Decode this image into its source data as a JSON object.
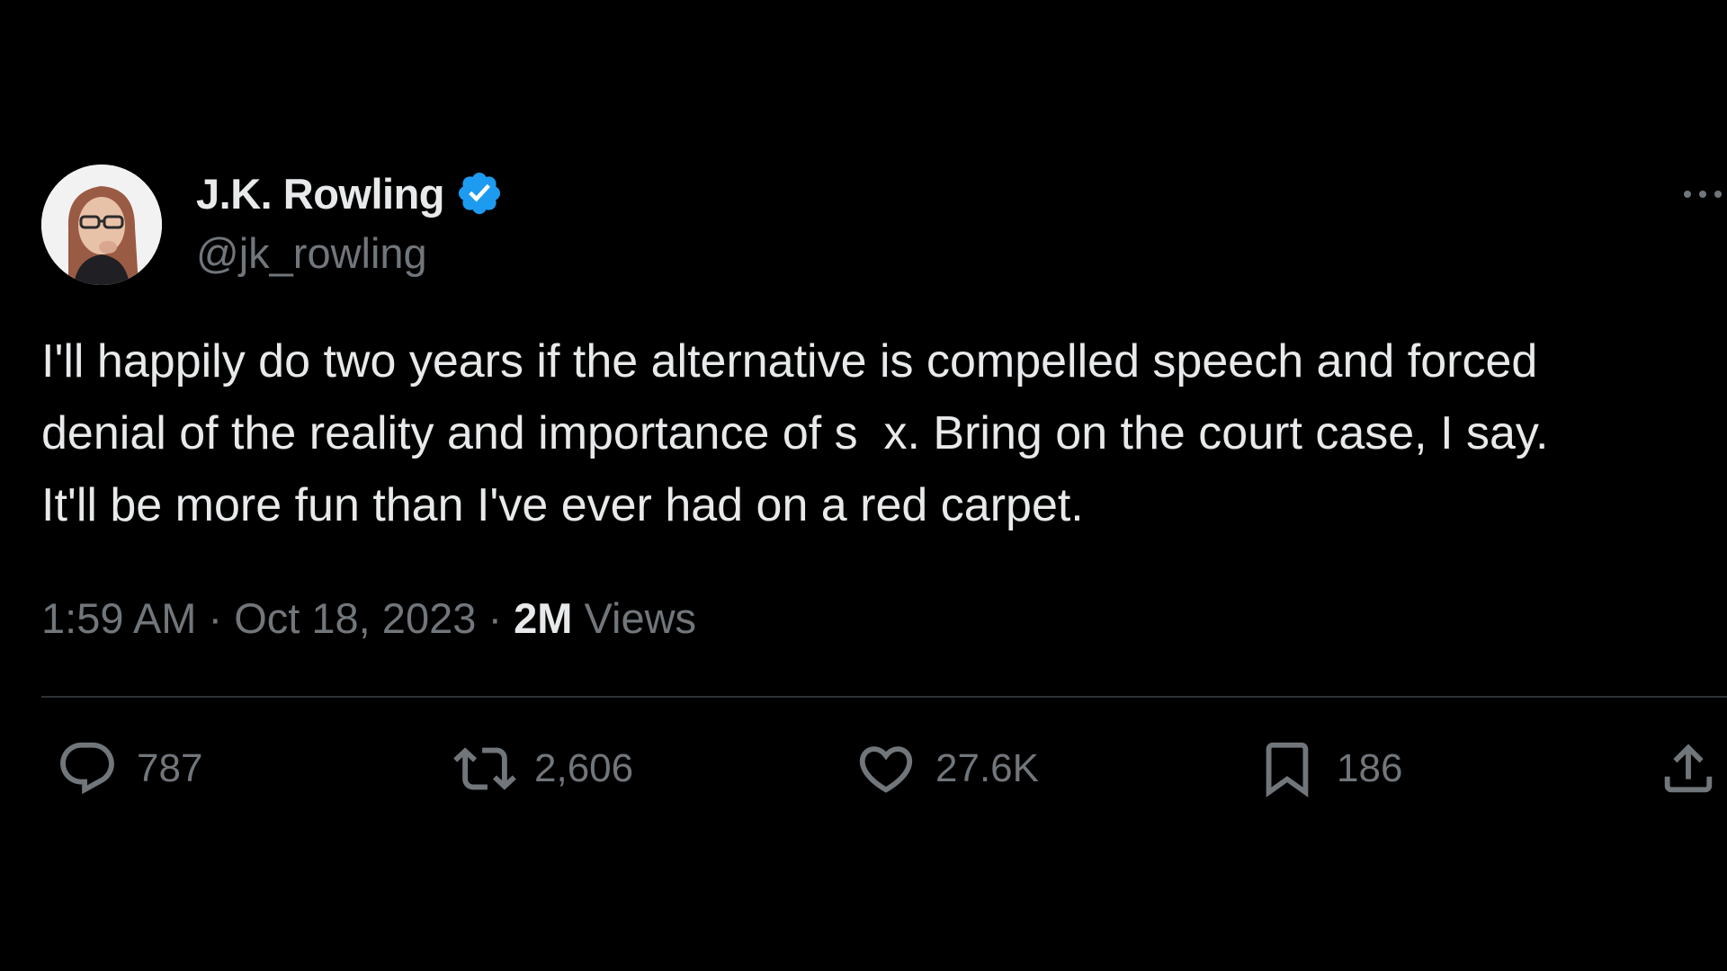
{
  "author": {
    "display_name": "J.K. Rowling",
    "handle": "@jk_rowling",
    "verified": true
  },
  "tweet": {
    "text_lines": [
      "I'll happily do two years if the alternative is compelled speech and forced",
      "denial of the reality and importance of s  x. Bring on the court case, I say.",
      "It'll be more fun than I've ever had on a red carpet."
    ],
    "time": "1:59 AM",
    "separator": "·",
    "date": "Oct 18, 2023",
    "views_count": "2M",
    "views_label": "Views"
  },
  "actions": {
    "replies": "787",
    "retweets": "2,606",
    "likes": "27.6K",
    "bookmarks": "186"
  },
  "icons": {
    "verified": "verified-badge-icon",
    "more": "more-options-icon",
    "reply": "reply-icon",
    "retweet": "retweet-icon",
    "like": "heart-icon",
    "bookmark": "bookmark-icon",
    "share": "share-icon"
  },
  "colors": {
    "background": "#000000",
    "primary_text": "#e7e9ea",
    "secondary_text": "#71767b",
    "verified_blue": "#1d9bf0",
    "divider": "#2f3336"
  }
}
